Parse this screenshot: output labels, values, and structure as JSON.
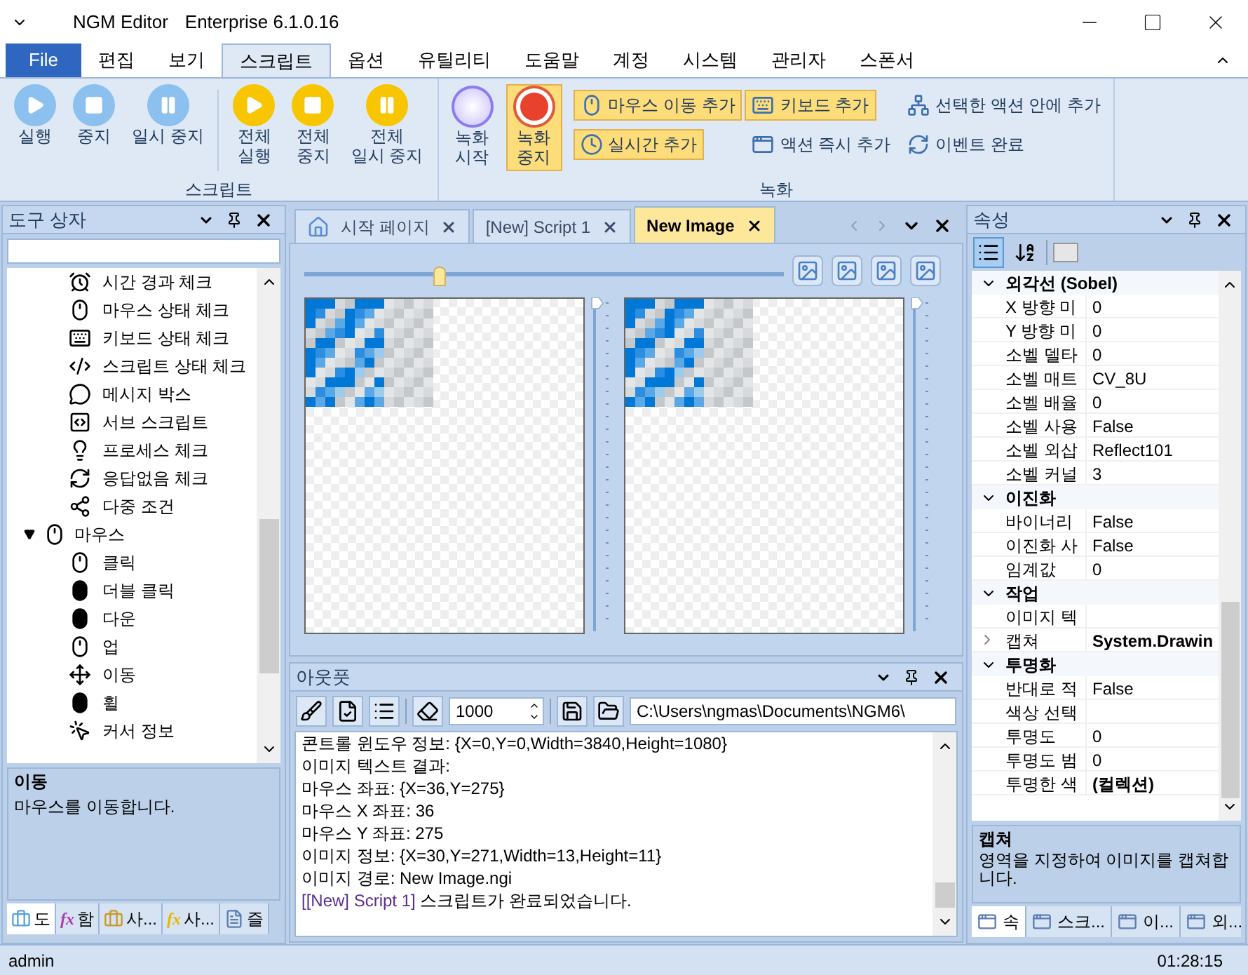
{
  "window": {
    "title": "NGM Editor",
    "edition": "Enterprise 6.1.0.16"
  },
  "menu_tabs": [
    {
      "label": "File",
      "kind": "file",
      "selected": false
    },
    {
      "label": "편집",
      "kind": "tab",
      "selected": false
    },
    {
      "label": "보기",
      "kind": "tab",
      "selected": false
    },
    {
      "label": "스크립트",
      "kind": "tab",
      "selected": true
    },
    {
      "label": "옵션",
      "kind": "tab",
      "selected": false
    },
    {
      "label": "유틸리티",
      "kind": "tab",
      "selected": false
    },
    {
      "label": "도움말",
      "kind": "tab",
      "selected": false
    },
    {
      "label": "계정",
      "kind": "tab",
      "selected": false
    },
    {
      "label": "시스템",
      "kind": "tab",
      "selected": false
    },
    {
      "label": "관리자",
      "kind": "tab",
      "selected": false
    },
    {
      "label": "스폰서",
      "kind": "tab",
      "selected": false
    }
  ],
  "ribbon": {
    "script_group": {
      "label": "스크립트",
      "buttons": [
        {
          "lines": [
            "실행"
          ],
          "kind": "play",
          "color": "#8cc0ee"
        },
        {
          "lines": [
            "중지"
          ],
          "kind": "stop",
          "color": "#8cc0ee"
        },
        {
          "lines": [
            "일시 중지"
          ],
          "kind": "pause",
          "color": "#8cc0ee"
        },
        {
          "lines": [
            "전체",
            "실행"
          ],
          "kind": "play",
          "color": "#f7c600"
        },
        {
          "lines": [
            "전체",
            "중지"
          ],
          "kind": "stop",
          "color": "#f7c600"
        },
        {
          "lines": [
            "전체",
            "일시 중지"
          ],
          "kind": "pause",
          "color": "#f7c600"
        }
      ]
    },
    "record_group": {
      "label": "녹화",
      "big_buttons": [
        {
          "lines": [
            "녹화",
            "시작"
          ],
          "kind": "record-start",
          "on": false
        },
        {
          "lines": [
            "녹화",
            "중지"
          ],
          "kind": "record-stop",
          "on": true
        }
      ],
      "small_buttons": [
        {
          "label": "마우스 이동 추가",
          "kind": "mouse",
          "on": true
        },
        {
          "label": "키보드 추가",
          "kind": "keyboard",
          "on": true
        },
        {
          "label": "선택한 액션 안에 추가",
          "kind": "tree",
          "on": false
        },
        {
          "label": "실시간 추가",
          "kind": "clock",
          "on": true
        },
        {
          "label": "액션 즉시 추가",
          "kind": "window",
          "on": false
        },
        {
          "label": "이벤트 완료",
          "kind": "refresh",
          "on": false
        }
      ]
    }
  },
  "toolbox": {
    "title": "도구 상자",
    "tree": [
      {
        "children": [
          {
            "label": "시간 경과 체크",
            "kind": "timer"
          },
          {
            "label": "마우스 상태 체크",
            "kind": "mouse"
          },
          {
            "label": "키보드 상태 체크",
            "kind": "keyboard"
          },
          {
            "label": "스크립트 상태 체크",
            "kind": "code"
          },
          {
            "label": "메시지 박스",
            "kind": "message"
          },
          {
            "label": "서브 스크립트",
            "kind": "subscript"
          },
          {
            "label": "프로세스 체크",
            "kind": "bulb"
          },
          {
            "label": "응답없음 체크",
            "kind": "refresh"
          },
          {
            "label": "다중 조건",
            "kind": "share"
          }
        ]
      },
      {
        "label": "마우스",
        "kind": "mouse",
        "expanded": true,
        "children": [
          {
            "label": "클릭",
            "kind": "mouse"
          },
          {
            "label": "더블 클릭",
            "kind": "mouse-filled"
          },
          {
            "label": "다운",
            "kind": "mouse-filled"
          },
          {
            "label": "업",
            "kind": "mouse"
          },
          {
            "label": "이동",
            "kind": "move"
          },
          {
            "label": "휠",
            "kind": "mouse-filled"
          },
          {
            "label": "커서 정보",
            "kind": "pointer"
          }
        ]
      }
    ],
    "description": {
      "title": "이동",
      "text": "마우스를 이동합니다."
    },
    "tabs": [
      {
        "label": "도",
        "kind": "toolbox",
        "selected": true
      },
      {
        "label": "함",
        "kind": "function",
        "icon": "fx",
        "color": "#b03ab0",
        "selected": false
      },
      {
        "label": "사...",
        "kind": "toolbox",
        "selected": false
      },
      {
        "label": "사...",
        "kind": "function",
        "icon": "fx",
        "color": "#e6b800",
        "selected": false
      },
      {
        "label": "즐",
        "kind": "document",
        "selected": false
      }
    ]
  },
  "documents": {
    "tabs": [
      {
        "label": "시작 페이지",
        "kind": "home",
        "selected": false
      },
      {
        "label": "[New] Script 1",
        "kind": "plain",
        "selected": false
      },
      {
        "label": "New Image",
        "kind": "plain",
        "selected": true
      }
    ],
    "zoom": {
      "level": 0.28
    },
    "image_panels": [
      {
        "level": 1
      },
      {
        "level": 1
      }
    ]
  },
  "output": {
    "title": "아웃풋",
    "interval": "1000",
    "path": "C:\\Users\\ngmas\\Documents\\NGM6\\",
    "lines": [
      {
        "text": "콘트롤 윈도우 정보: {X=0,Y=0,Width=3840,Height=1080}"
      },
      {
        "text": "이미지 텍스트 결과:"
      },
      {
        "text": "마우스 좌표: {X=36,Y=275}"
      },
      {
        "text": "마우스 X 좌표: 36"
      },
      {
        "text": "마우스 Y 좌표: 275"
      },
      {
        "text": "이미지 정보: {X=30,Y=271,Width=13,Height=11}"
      },
      {
        "text": "이미지 경로: New Image.ngi"
      },
      {
        "source": "[[New] Script 1]",
        "text": "스크립트가 완료되었습니다."
      }
    ]
  },
  "properties": {
    "title": "속성",
    "sort_categorized": {
      "selected": true
    },
    "sort_alphabetical": {
      "selected": false
    },
    "categories": [
      {
        "label": "외각선 (Sobel)",
        "expanded": true,
        "rows": [
          {
            "name": "X 방향 미",
            "value": "0"
          },
          {
            "name": "Y 방향 미",
            "value": "0"
          },
          {
            "name": "소벨 델타",
            "value": "0"
          },
          {
            "name": "소벨 매트",
            "value": "CV_8U"
          },
          {
            "name": "소벨 배율",
            "value": "0"
          },
          {
            "name": "소벨 사용",
            "value": "False"
          },
          {
            "name": "소벨 외삽",
            "value": "Reflect101"
          },
          {
            "name": "소벨 커널",
            "value": "3"
          }
        ]
      },
      {
        "label": "이진화",
        "expanded": true,
        "rows": [
          {
            "name": "바이너리",
            "value": "False"
          },
          {
            "name": "이진화 사",
            "value": "False"
          },
          {
            "name": "임계값",
            "value": "0"
          }
        ]
      },
      {
        "label": "작업",
        "expanded": true,
        "rows": [
          {
            "name": "이미지 텍"
          },
          {
            "name": "캡쳐",
            "value": "System.Drawin",
            "modified": true,
            "expanded": false
          }
        ]
      },
      {
        "label": "투명화",
        "expanded": true,
        "rows": [
          {
            "name": "반대로 적",
            "value": "False"
          },
          {
            "name": "색상 선택"
          },
          {
            "name": "투명도",
            "value": "0"
          },
          {
            "name": "투명도 범",
            "value": "0"
          },
          {
            "name": "투명한 색",
            "value": "(컬렉션)",
            "modified": true
          }
        ]
      }
    ],
    "description": {
      "title": "캡쳐",
      "text": "영역을 지정하여 이미지를 캡쳐합니다."
    },
    "tabs": [
      {
        "label": "속",
        "selected": true
      },
      {
        "label": "스크...",
        "selected": false
      },
      {
        "label": "이...",
        "selected": false
      },
      {
        "label": "외...",
        "selected": false
      }
    ]
  },
  "status_bar": {
    "user": "admin",
    "time": "01:28:15"
  }
}
